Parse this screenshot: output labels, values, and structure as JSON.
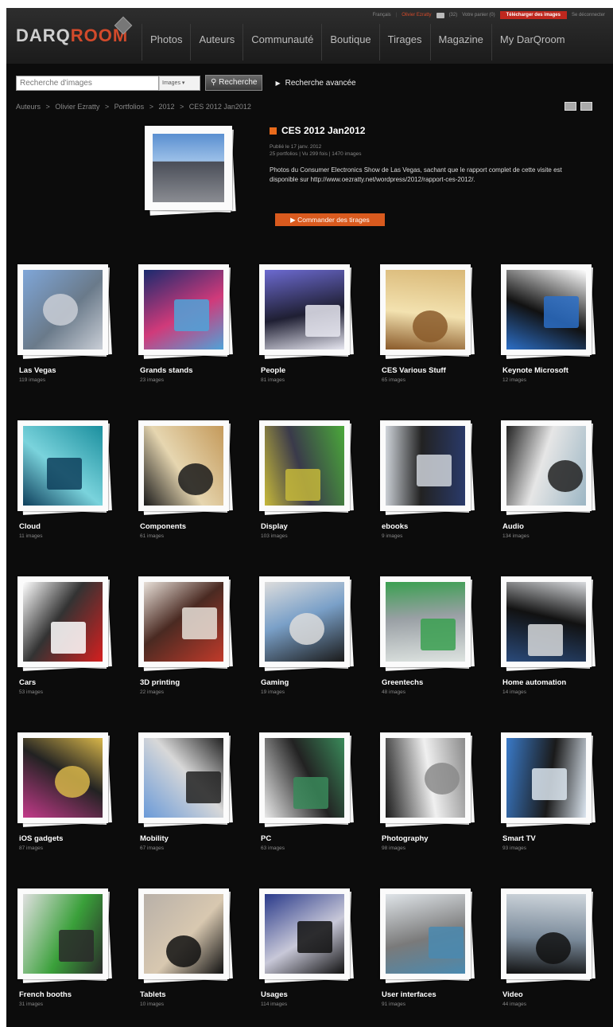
{
  "header": {
    "logo_part1": "DARQ",
    "logo_part2": "ROOM",
    "util": {
      "lang": "Français",
      "user": "Olivier Ezratty",
      "counter": "(32)",
      "cart": "Votre panier (0)",
      "download": "Télécharger des images",
      "logout": "Se déconnecter"
    },
    "nav": [
      "Photos",
      "Auteurs",
      "Communauté",
      "Boutique",
      "Tirages",
      "Magazine",
      "My DarQroom"
    ]
  },
  "search": {
    "placeholder": "Recherche d'images",
    "scope": "Images",
    "button": "Recherche",
    "advanced": "Recherche avancée"
  },
  "breadcrumb": [
    "Auteurs",
    ">",
    "Olivier Ezratty",
    ">",
    "Portfolios",
    ">",
    "2012",
    ">",
    "CES 2012 Jan2012"
  ],
  "album": {
    "title": "CES 2012 Jan2012",
    "published": "Publié le 17 janv. 2012",
    "stats": "25 portfolios | Vu 299 fois | 1470 images",
    "description": "Photos du Consumer Electronics Show de Las Vegas, sachant que le rapport complet de cette visite est disponible sur http://www.oezratty.net/wordpress/2012/rapport-ces-2012/.",
    "order_button": "Commander des tirages"
  },
  "colors": {
    "accent": "#d95a1e",
    "brand_red": "#d24a2b",
    "background": "#0c0c0c"
  },
  "portfolios": [
    {
      "name": "Las Vegas",
      "count": "119 images",
      "theme": [
        "#7fa6d8",
        "#c9ced6",
        "#6a7a8a"
      ]
    },
    {
      "name": "Grands stands",
      "count": "23 images",
      "theme": [
        "#1a2a6e",
        "#4fa3d8",
        "#d03a7a"
      ]
    },
    {
      "name": "People",
      "count": "81 images",
      "theme": [
        "#6c6ad0",
        "#e6e6f0",
        "#1f1f33"
      ]
    },
    {
      "name": "CES Various Stuff",
      "count": "65 images",
      "theme": [
        "#d9b877",
        "#8a5a2a",
        "#f3e2b0"
      ]
    },
    {
      "name": "Keynote Microsoft",
      "count": "12 images",
      "theme": [
        "#ffffff",
        "#2c6fc7",
        "#111111"
      ]
    },
    {
      "name": "Cloud",
      "count": "11 images",
      "theme": [
        "#1b8f9e",
        "#0e3f5c",
        "#7ad3dc"
      ]
    },
    {
      "name": "Components",
      "count": "61 images",
      "theme": [
        "#c49a5b",
        "#1a1a1a",
        "#e6d6b0"
      ]
    },
    {
      "name": "Display",
      "count": "103 images",
      "theme": [
        "#4aa83a",
        "#c6b83a",
        "#3a3a4a"
      ]
    },
    {
      "name": "ebooks",
      "count": "9 images",
      "theme": [
        "#2a3a6a",
        "#cfd4da",
        "#222222"
      ]
    },
    {
      "name": "Audio",
      "count": "134 images",
      "theme": [
        "#9cb6c4",
        "#222222",
        "#e6e6e6"
      ]
    },
    {
      "name": "Cars",
      "count": "53 images",
      "theme": [
        "#d51f1f",
        "#ffffff",
        "#333333"
      ]
    },
    {
      "name": "3D printing",
      "count": "22 images",
      "theme": [
        "#c13a2a",
        "#e8e0d8",
        "#4a2a22"
      ]
    },
    {
      "name": "Gaming",
      "count": "19 images",
      "theme": [
        "#1a1a1a",
        "#dcdcdc",
        "#7aa0c8"
      ]
    },
    {
      "name": "Greentechs",
      "count": "48 images",
      "theme": [
        "#dde3e0",
        "#3aa050",
        "#9aa0a5"
      ]
    },
    {
      "name": "Home automation",
      "count": "14 images",
      "theme": [
        "#2a4a7a",
        "#d7d9dc",
        "#111111"
      ]
    },
    {
      "name": "iOS gadgets",
      "count": "87 images",
      "theme": [
        "#c33a8a",
        "#d8b64a",
        "#222222"
      ]
    },
    {
      "name": "Mobility",
      "count": "67 images",
      "theme": [
        "#6a9ad8",
        "#222222",
        "#d8d8d8"
      ]
    },
    {
      "name": "PC",
      "count": "63 images",
      "theme": [
        "#e8e8e8",
        "#3a8a5a",
        "#222222"
      ]
    },
    {
      "name": "Photography",
      "count": "98 images",
      "theme": [
        "#1a1a1a",
        "#8a8a8a",
        "#f0f0f0"
      ]
    },
    {
      "name": "Smart TV",
      "count": "93 images",
      "theme": [
        "#3a7ac8",
        "#dce6f0",
        "#1a1a1a"
      ]
    },
    {
      "name": "French booths",
      "count": "31 images",
      "theme": [
        "#e0e0e0",
        "#2a2a2a",
        "#3aa03a"
      ]
    },
    {
      "name": "Tablets",
      "count": "10 images",
      "theme": [
        "#b8b0a8",
        "#111111",
        "#d8c8b0"
      ]
    },
    {
      "name": "Usages",
      "count": "114 images",
      "theme": [
        "#2a3a8a",
        "#111111",
        "#c8c8d8"
      ]
    },
    {
      "name": "User interfaces",
      "count": "91 images",
      "theme": [
        "#dfe4e8",
        "#4a8ab0",
        "#7a7a7a"
      ]
    },
    {
      "name": "Video",
      "count": "44 images",
      "theme": [
        "#cfd6dc",
        "#111111",
        "#7a8a9a"
      ]
    }
  ]
}
